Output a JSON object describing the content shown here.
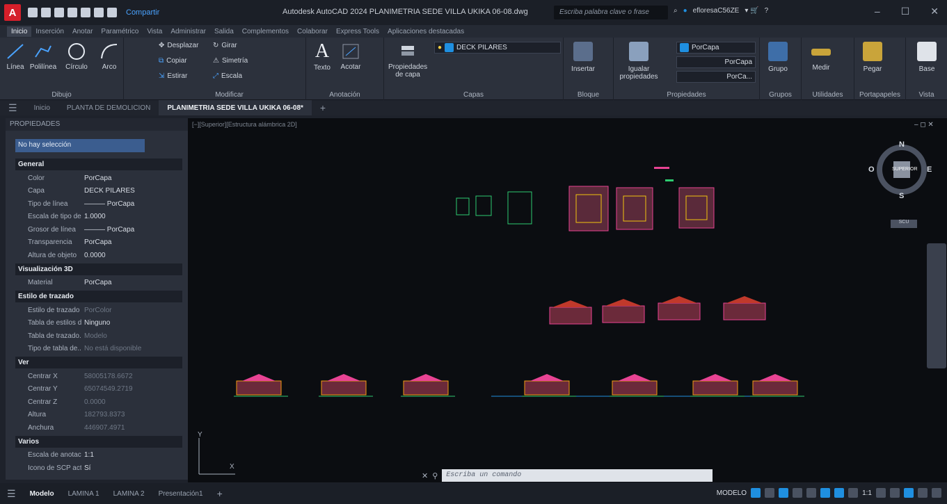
{
  "titlebar": {
    "logo": "A",
    "share": "Compartir",
    "title": "Autodesk AutoCAD 2024   PLANIMETRIA SEDE VILLA UKIKA 06-08.dwg",
    "search_placeholder": "Escriba palabra clave o frase",
    "user": "efloresaC56ZE"
  },
  "ribbon_tabs": [
    "Inicio",
    "Inserción",
    "Anotar",
    "Paramétrico",
    "Vista",
    "Administrar",
    "Salida",
    "Complementos",
    "Colaborar",
    "Express Tools",
    "Aplicaciones destacadas"
  ],
  "ribbon": {
    "dibujo": {
      "title": "Dibujo",
      "linea": "Línea",
      "polilinea": "Polilínea",
      "circulo": "Círculo",
      "arco": "Arco"
    },
    "modificar": {
      "title": "Modificar",
      "desplazar": "Desplazar",
      "girar": "Girar",
      "copiar": "Copiar",
      "simetria": "Simetría",
      "estirar": "Estirar",
      "escala": "Escala"
    },
    "anotacion": {
      "title": "Anotación",
      "texto": "Texto",
      "acotar": "Acotar"
    },
    "capas": {
      "title": "Capas",
      "propiedades": "Propiedades",
      "de_capa": "de capa",
      "current": "DECK PILARES"
    },
    "bloque": {
      "title": "Bloque",
      "insertar": "Insertar"
    },
    "propiedades": {
      "title": "Propiedades",
      "igualar": "Igualar",
      "props": "propiedades",
      "color": "PorCapa",
      "linetype": "PorCapa",
      "lineweight": "PorCa..."
    },
    "grupos": {
      "title": "Grupos",
      "grupo": "Grupo"
    },
    "utilidades": {
      "title": "Utilidades",
      "medir": "Medir"
    },
    "portapapeles": {
      "title": "Portapapeles",
      "pegar": "Pegar"
    },
    "vista": {
      "title": "Vista",
      "base": "Base"
    }
  },
  "doctabs": [
    "Inicio",
    "PLANTA DE DEMOLICION",
    "PLANIMETRIA SEDE VILLA UKIKA 06-08*"
  ],
  "properties": {
    "header": "PROPIEDADES",
    "selection": "No hay selección",
    "groups": [
      {
        "name": "General",
        "rows": [
          [
            "Color",
            "PorCapa"
          ],
          [
            "Capa",
            "DECK PILARES"
          ],
          [
            "Tipo de línea",
            "——— PorCapa"
          ],
          [
            "Escala de tipo de...",
            "1.0000"
          ],
          [
            "Grosor de línea",
            "——— PorCapa"
          ],
          [
            "Transparencia",
            "PorCapa"
          ],
          [
            "Altura de objeto",
            "0.0000"
          ]
        ]
      },
      {
        "name": "Visualización 3D",
        "rows": [
          [
            "Material",
            "PorCapa"
          ]
        ]
      },
      {
        "name": "Estilo de trazado",
        "rows": [
          [
            "Estilo de trazado",
            "PorColor"
          ],
          [
            "Tabla de estilos d...",
            "Ninguno"
          ],
          [
            "Tabla de trazado...",
            "Modelo"
          ],
          [
            "Tipo de tabla de...",
            "No está disponible"
          ]
        ]
      },
      {
        "name": "Ver",
        "rows": [
          [
            "Centrar X",
            "58005178.6672"
          ],
          [
            "Centrar Y",
            "65074549.2719"
          ],
          [
            "Centrar Z",
            "0.0000"
          ],
          [
            "Altura",
            "182793.8373"
          ],
          [
            "Anchura",
            "446907.4971"
          ]
        ]
      },
      {
        "name": "Varios",
        "rows": [
          [
            "Escala de anotaci...",
            "1:1"
          ],
          [
            "Icono de SCP act...",
            "Sí"
          ]
        ]
      }
    ]
  },
  "canvas": {
    "viewport_label": "[−][Superior][Estructura alámbrica 2D]",
    "viewcube": {
      "n": "N",
      "s": "S",
      "e": "E",
      "o": "O",
      "face": "SUPERIOR",
      "scu": "SCU"
    },
    "ucs_x": "X",
    "ucs_y": "Y"
  },
  "command": {
    "placeholder": "Escriba un comando"
  },
  "status": {
    "tabs": [
      "Modelo",
      "LAMINA 1",
      "LAMINA 2",
      "Presentación1"
    ],
    "mode": "MODELO",
    "scale": "1:1"
  }
}
